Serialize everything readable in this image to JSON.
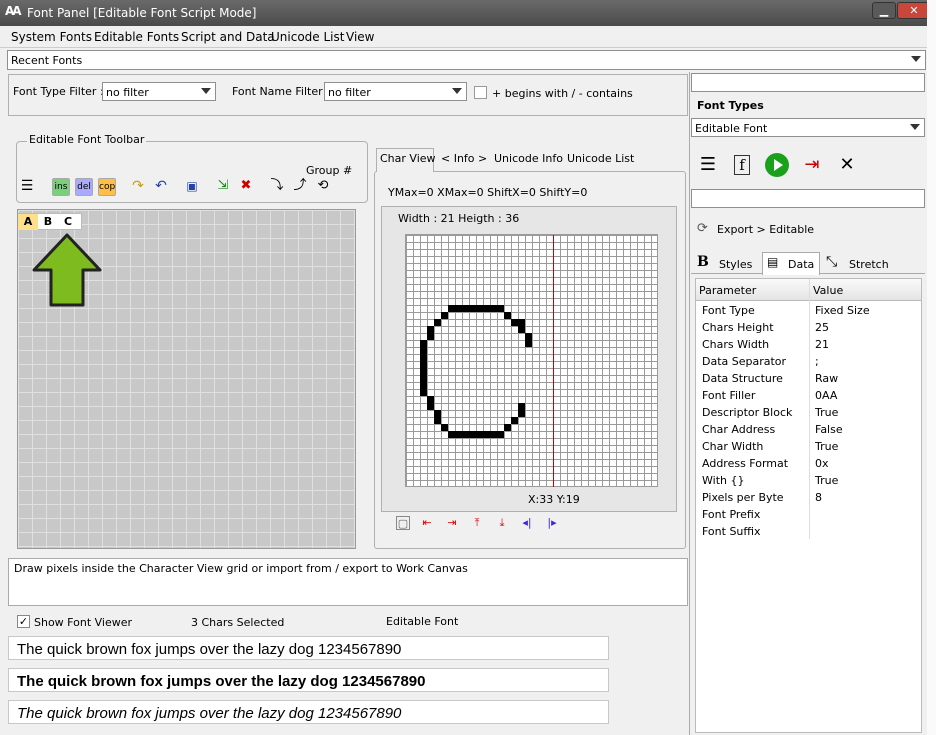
{
  "window": {
    "logo": "AA",
    "title": "Font Panel [Editable Font Script Mode]"
  },
  "menu": [
    "System Fonts",
    "Editable Fonts",
    "Script and Data",
    "Unicode List",
    "View"
  ],
  "recent_fonts": "Recent Fonts",
  "filters": {
    "type_label": "Font Type Filter :",
    "type_value": "no filter",
    "name_label": "Font Name Filter :",
    "name_value": "no filter",
    "begins_label": "+ begins with / - contains"
  },
  "toolbar": {
    "title": "Editable Font Toolbar",
    "group_label": "Group #",
    "ins": "ins",
    "del": "del",
    "cop": "cop"
  },
  "chars": [
    "A",
    "B",
    "C"
  ],
  "tabs": [
    "Char View",
    "< Info >",
    "Unicode Info",
    "Unicode List"
  ],
  "char_view": {
    "metrics": "YMax=0  XMax=0  ShiftX=0  ShiftY=0",
    "size": "Width : 21  Heigth : 36",
    "coords": "X:33 Y:19"
  },
  "glyph_pixels": [
    [
      6,
      10
    ],
    [
      7,
      10
    ],
    [
      8,
      10
    ],
    [
      9,
      10
    ],
    [
      10,
      10
    ],
    [
      11,
      10
    ],
    [
      12,
      10
    ],
    [
      13,
      10
    ],
    [
      5,
      11
    ],
    [
      14,
      11
    ],
    [
      4,
      12
    ],
    [
      15,
      12
    ],
    [
      16,
      12
    ],
    [
      3,
      13
    ],
    [
      16,
      13
    ],
    [
      3,
      14
    ],
    [
      17,
      14
    ],
    [
      2,
      15
    ],
    [
      17,
      15
    ],
    [
      2,
      16
    ],
    [
      2,
      17
    ],
    [
      2,
      18
    ],
    [
      2,
      19
    ],
    [
      2,
      20
    ],
    [
      2,
      21
    ],
    [
      2,
      22
    ],
    [
      3,
      23
    ],
    [
      3,
      24
    ],
    [
      16,
      24
    ],
    [
      4,
      25
    ],
    [
      16,
      25
    ],
    [
      4,
      26
    ],
    [
      15,
      26
    ],
    [
      5,
      27
    ],
    [
      14,
      27
    ],
    [
      6,
      28
    ],
    [
      7,
      28
    ],
    [
      8,
      28
    ],
    [
      9,
      28
    ],
    [
      10,
      28
    ],
    [
      11,
      28
    ],
    [
      12,
      28
    ],
    [
      13,
      28
    ]
  ],
  "status_text": "Draw pixels inside the Character View grid or import from / export to Work Canvas",
  "viewer": {
    "checkbox": "Show Font Viewer",
    "selected": "3 Chars Selected",
    "kind": "Editable Font"
  },
  "sample_text": "The quick brown fox jumps over the lazy dog 1234567890",
  "right": {
    "font_types_label": "Font Types",
    "font_type_value": "Editable Font",
    "export_label": "Export > Editable",
    "tabs": [
      "Styles",
      "Data",
      "Stretch"
    ],
    "columns": [
      "Parameter",
      "Value"
    ],
    "params": [
      {
        "p": "Font Type",
        "v": "Fixed Size"
      },
      {
        "p": "Chars Height",
        "v": "25"
      },
      {
        "p": "Chars Width",
        "v": "21"
      },
      {
        "p": "Data Separator",
        "v": ";"
      },
      {
        "p": "Data Structure",
        "v": "Raw"
      },
      {
        "p": "Font Filler",
        "v": "0AA"
      },
      {
        "p": "Descriptor Block",
        "v": "True"
      },
      {
        "p": "Char Address",
        "v": "False"
      },
      {
        "p": "Char Width",
        "v": "True"
      },
      {
        "p": "Address Format",
        "v": "0x"
      },
      {
        "p": "With {}",
        "v": "True"
      },
      {
        "p": "Pixels per Byte",
        "v": "8"
      },
      {
        "p": "Font Prefix",
        "v": ""
      },
      {
        "p": "Font Suffix",
        "v": ""
      }
    ]
  },
  "colors": {
    "arrow": "#7dbb1f",
    "cursor_line": "#cc0000",
    "play": "#1aa01a"
  }
}
